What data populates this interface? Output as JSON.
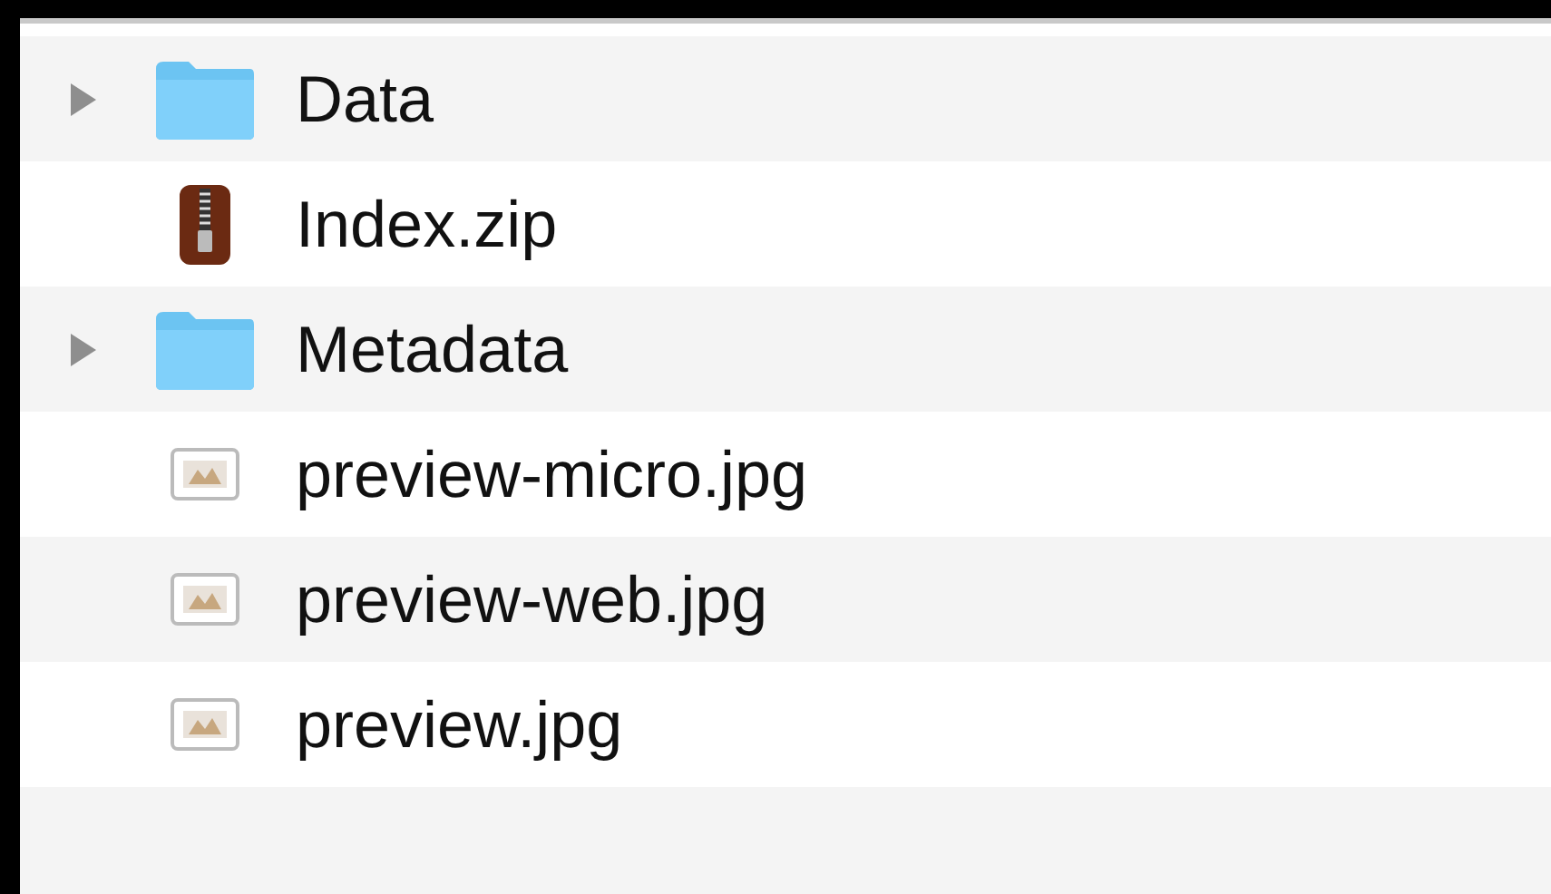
{
  "files": [
    {
      "kind": "folder",
      "name": "Data",
      "expanded": false
    },
    {
      "kind": "archive",
      "name": "Index.zip"
    },
    {
      "kind": "folder",
      "name": "Metadata",
      "expanded": false
    },
    {
      "kind": "image",
      "name": "preview-micro.jpg"
    },
    {
      "kind": "image",
      "name": "preview-web.jpg"
    },
    {
      "kind": "image",
      "name": "preview.jpg"
    }
  ]
}
